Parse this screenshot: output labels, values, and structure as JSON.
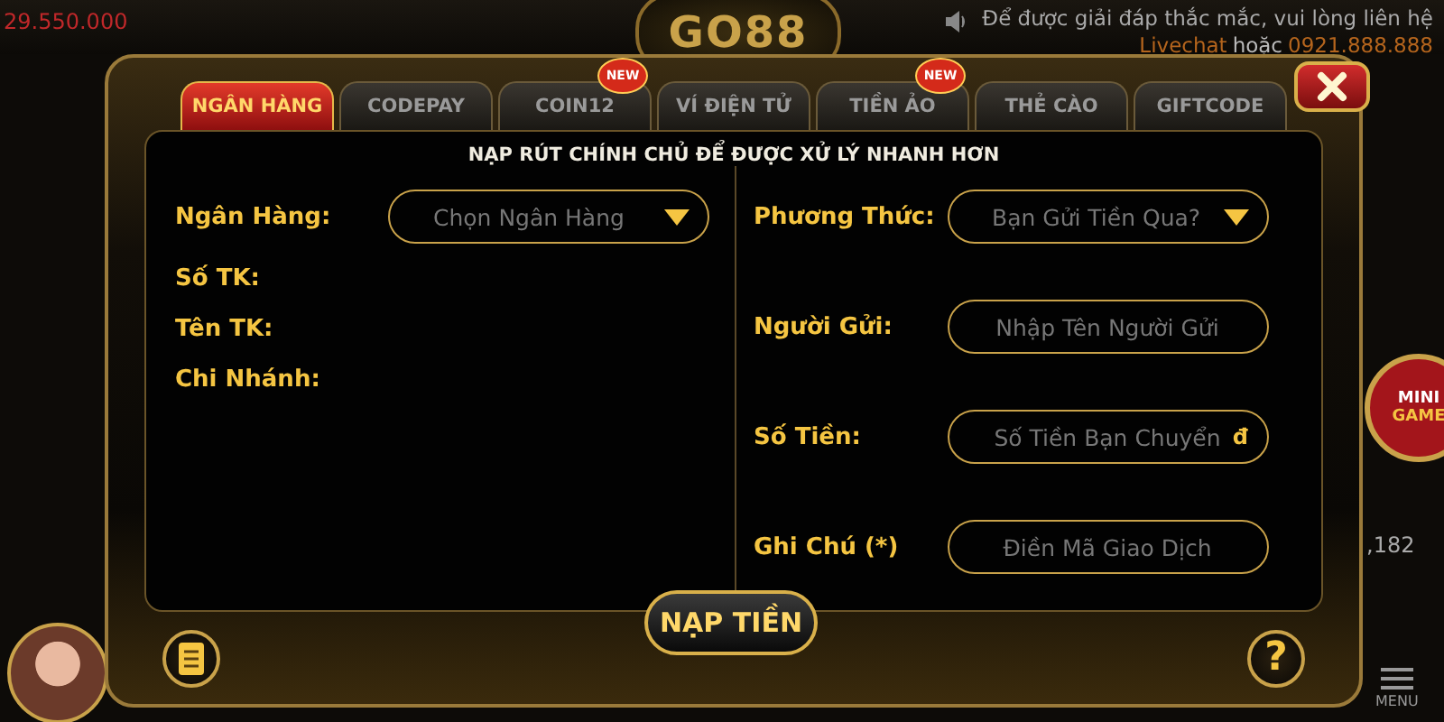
{
  "header": {
    "balance": "29.550.000",
    "logo": "GO88",
    "help_line": "Để được giải đáp thắc mắc, vui lòng liên hệ",
    "livechat": "Livechat",
    "or": "hoặc",
    "phone": "0921.888.888"
  },
  "side": {
    "mini_game_top": "MINI",
    "mini_game_bottom": "GAME",
    "jackpot": ",182",
    "menu": "MENU"
  },
  "dialog": {
    "tabs": [
      {
        "label": "NGÂN HÀNG",
        "selected": true
      },
      {
        "label": "CODEPAY",
        "selected": false
      },
      {
        "label": "COIN12",
        "selected": false,
        "badge": "NEW"
      },
      {
        "label": "VÍ ĐIỆN TỬ",
        "selected": false
      },
      {
        "label": "TIỀN ẢO",
        "selected": false,
        "badge": "NEW"
      },
      {
        "label": "THẺ CÀO",
        "selected": false
      },
      {
        "label": "GIFTCODE",
        "selected": false
      }
    ],
    "notice": "NẠP RÚT CHÍNH CHỦ ĐỂ ĐƯỢC XỬ LÝ NHANH HƠN",
    "left_fields": [
      {
        "kind": "select",
        "label": "Ngân Hàng:",
        "placeholder": "Chọn Ngân Hàng"
      },
      {
        "kind": "info",
        "label": "Số TK:"
      },
      {
        "kind": "info",
        "label": "Tên TK:"
      },
      {
        "kind": "info",
        "label": "Chi Nhánh:"
      }
    ],
    "right_fields": [
      {
        "kind": "select",
        "label": "Phương Thức:",
        "placeholder": "Bạn Gửi Tiền Qua?"
      },
      {
        "kind": "input",
        "label": "Người Gửi:",
        "placeholder": "Nhập Tên Người Gửi"
      },
      {
        "kind": "input",
        "label": "Số Tiền:",
        "placeholder": "Số Tiền Bạn Chuyển",
        "suffix": "đ"
      },
      {
        "kind": "input",
        "label": "Ghi Chú (*)",
        "placeholder": "Điền Mã Giao Dịch"
      }
    ],
    "submit": "NẠP TIỀN",
    "help_button": "?"
  }
}
